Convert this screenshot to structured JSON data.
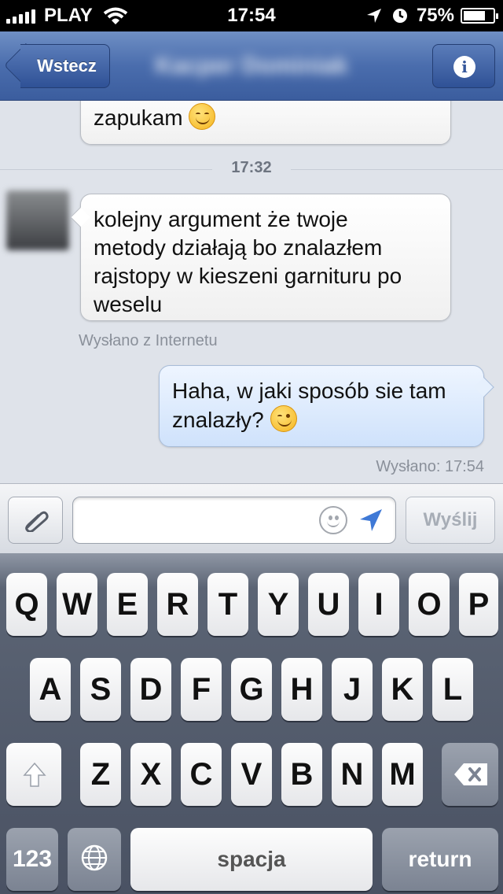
{
  "status_bar": {
    "carrier": "PLAY",
    "time": "17:54",
    "battery": "75%",
    "battery_level": 0.75
  },
  "nav": {
    "back_label": "Wstecz",
    "title": "Kacper Dominiak",
    "info_icon": "info-icon"
  },
  "messages": [
    {
      "type": "incoming",
      "text": "zapukam",
      "emoji": "smile"
    },
    {
      "type": "time_separator",
      "text": "17:32"
    },
    {
      "type": "incoming",
      "text_lines": [
        "kolejny argument że twoje",
        "metody działają bo znalazłem",
        "rajstopy w kieszeni garnituru po",
        "weselu"
      ],
      "meta": "Wysłano z Internetu"
    },
    {
      "type": "outgoing",
      "text_lines": [
        "Haha, w jaki sposób sie tam",
        "znalazły?"
      ],
      "emoji": "wink",
      "meta": "Wysłano: 17:54"
    }
  ],
  "composer": {
    "input_value": "",
    "send_label": "Wyślij"
  },
  "keyboard": {
    "row1": [
      "Q",
      "W",
      "E",
      "R",
      "T",
      "Y",
      "U",
      "I",
      "O",
      "P"
    ],
    "row2": [
      "A",
      "S",
      "D",
      "F",
      "G",
      "H",
      "J",
      "K",
      "L"
    ],
    "row3": [
      "Z",
      "X",
      "C",
      "V",
      "B",
      "N",
      "M"
    ],
    "numbers_label": "123",
    "space_label": "spacja",
    "return_label": "return"
  },
  "colors": {
    "nav_blue": "#4a6dad",
    "outgoing_bubble": "#d8e8fc",
    "incoming_bubble": "#ffffff",
    "chat_bg": "#dfe3ea"
  }
}
